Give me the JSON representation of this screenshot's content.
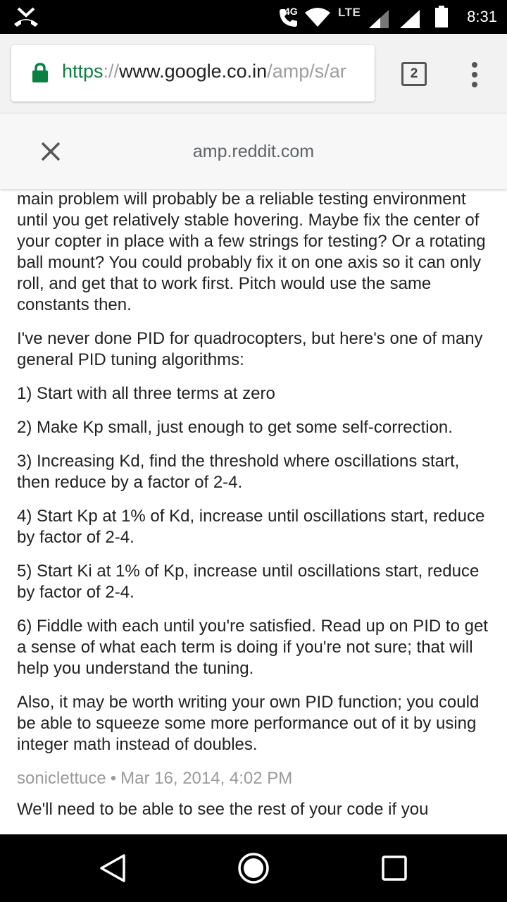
{
  "status_bar": {
    "network_label": "4G",
    "lte_label": "LTE",
    "time": "8:31",
    "icons": [
      "missed-call-icon",
      "call-icon",
      "wifi-icon",
      "signal-icon",
      "signal-icon",
      "battery-icon"
    ]
  },
  "browser": {
    "url_scheme": "https",
    "url_sep": "://",
    "url_host": "www.google.co.in",
    "url_path": "/amp/s/ar",
    "tab_count": "2",
    "colors": {
      "secure": "#0b8043"
    }
  },
  "amp_header": {
    "domain": "amp.reddit.com"
  },
  "content": {
    "paragraphs": [
      "main problem will probably be a reliable testing environment until you get relatively stable hovering. Maybe fix the center of your copter in place with a few strings for testing? Or a rotating ball mount? You could probably fix it on one axis so it can only roll, and get that to work first. Pitch would use the same constants then.",
      "I've never done PID for quadrocopters, but here's one of many general PID tuning algorithms:",
      "1) Start with all three terms at zero",
      "2) Make Kp small, just enough to get some self-correction.",
      "3) Increasing Kd, find the threshold where oscillations start, then reduce by a factor of 2-4.",
      "4) Start Kp at 1% of Kd, increase until oscillations start, reduce by factor of 2-4.",
      "5) Start Ki at 1% of Kp, increase until oscillations start, reduce by factor of 2-4.",
      "6) Fiddle with each until you're satisfied. Read up on PID to get a sense of what each term is doing if you're not sure; that will help you understand the tuning.",
      "Also, it may be worth writing your own PID function; you could be able to squeeze some more performance out of it by using integer math instead of doubles."
    ],
    "next_comment": {
      "author": "soniclettuce",
      "separator": "•",
      "timestamp": "Mar 16, 2014, 4:02 PM",
      "text": "We'll need to be able to see the rest of your code if you"
    }
  }
}
